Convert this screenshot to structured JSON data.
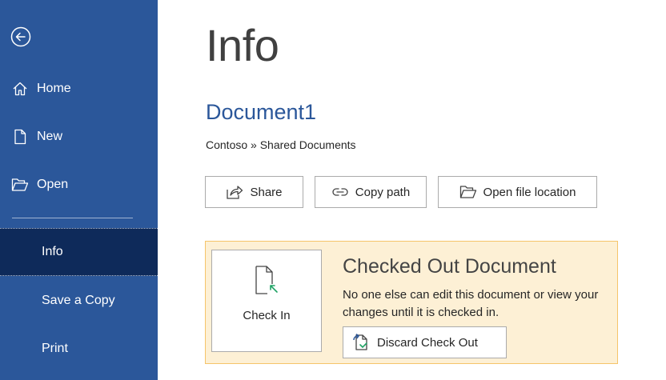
{
  "sidebar": {
    "items": [
      {
        "label": "Home",
        "icon": "home-icon"
      },
      {
        "label": "New",
        "icon": "new-document-icon"
      },
      {
        "label": "Open",
        "icon": "folder-open-icon"
      },
      {
        "label": "Info",
        "active": true
      },
      {
        "label": "Save a Copy"
      },
      {
        "label": "Print"
      }
    ],
    "background": "#2b579a",
    "active_background": "#0e2a5a"
  },
  "main": {
    "title": "Info",
    "document_name": "Document1",
    "location": "Contoso » Shared Documents",
    "accent_color": "#2b579a",
    "actions": [
      {
        "label": "Share",
        "icon": "share-icon"
      },
      {
        "label": "Copy path",
        "icon": "link-icon"
      },
      {
        "label": "Open file location",
        "icon": "folder-open-icon"
      }
    ]
  },
  "checked_out_panel": {
    "check_in_label": "Check In",
    "title": "Checked Out Document",
    "description": "No one else can edit this document or view your changes until it is checked in.",
    "discard_label": "Discard Check Out",
    "background": "#fdf0d5",
    "border_color": "#f5c46a"
  }
}
